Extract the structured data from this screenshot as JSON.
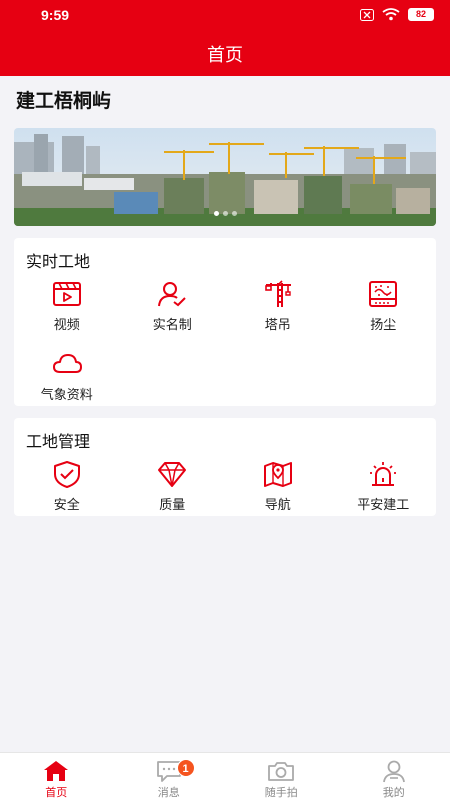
{
  "status_bar": {
    "time": "9:59",
    "battery": "82"
  },
  "nav": {
    "title": "首页"
  },
  "project": {
    "name": "建工梧桐屿"
  },
  "banner": {
    "image": "construction-site-photo"
  },
  "colors": {
    "brand": "#e60012",
    "badge": "#f5541f"
  },
  "realtime": {
    "title": "实时工地",
    "items": [
      {
        "label": "视频",
        "icon": "video-icon"
      },
      {
        "label": "实名制",
        "icon": "user-verify-icon"
      },
      {
        "label": "塔吊",
        "icon": "tower-crane-icon"
      },
      {
        "label": "扬尘",
        "icon": "dust-monitor-icon"
      },
      {
        "label": "气象资料",
        "icon": "cloud-icon"
      }
    ]
  },
  "management": {
    "title": "工地管理",
    "items": [
      {
        "label": "安全",
        "icon": "shield-check-icon"
      },
      {
        "label": "质量",
        "icon": "diamond-icon"
      },
      {
        "label": "导航",
        "icon": "map-pin-icon"
      },
      {
        "label": "平安建工",
        "icon": "alarm-light-icon"
      }
    ]
  },
  "tabbar": {
    "items": [
      {
        "label": "首页",
        "icon": "home-icon"
      },
      {
        "label": "消息",
        "icon": "message-icon",
        "badge": "1"
      },
      {
        "label": "随手拍",
        "icon": "camera-icon"
      },
      {
        "label": "我的",
        "icon": "profile-icon"
      }
    ]
  }
}
